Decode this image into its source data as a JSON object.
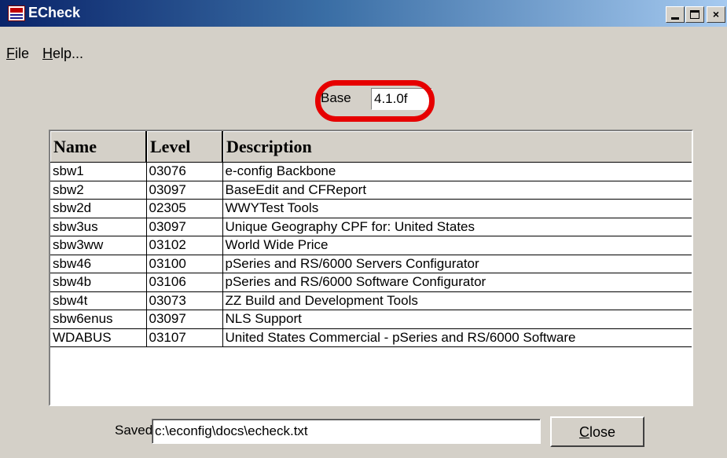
{
  "window": {
    "title": "ECheck",
    "controls": {
      "minimize": "_",
      "maximize": "□",
      "close": "×"
    }
  },
  "menu": {
    "file_label": "File",
    "help_label": "Help...",
    "file_mnemonic": "F",
    "file_rest": "ile",
    "help_mnemonic": "H",
    "help_rest": "elp..."
  },
  "base": {
    "label": "Base",
    "value": "4.1.0f"
  },
  "highlight_color": "#e60000",
  "table": {
    "columns": [
      "Name",
      "Level",
      "Description"
    ],
    "rows": [
      [
        "sbw1",
        "03076",
        "e-config Backbone"
      ],
      [
        "sbw2",
        "03097",
        "BaseEdit and CFReport"
      ],
      [
        "sbw2d",
        "02305",
        "WWYTest Tools"
      ],
      [
        "sbw3us",
        "03097",
        "Unique Geography CPF for: United States"
      ],
      [
        "sbw3ww",
        "03102",
        "World Wide Price"
      ],
      [
        "sbw46",
        "03100",
        "pSeries and RS/6000 Servers Configurator"
      ],
      [
        "sbw4b",
        "03106",
        "pSeries and RS/6000 Software Configurator"
      ],
      [
        "sbw4t",
        "03073",
        "ZZ Build and Development Tools"
      ],
      [
        "sbw6enus",
        "03097",
        "NLS Support"
      ],
      [
        "WDABUS",
        "03107",
        "United States Commercial - pSeries and RS/6000 Software"
      ]
    ]
  },
  "saved": {
    "label": "Saved",
    "path": "c:\\econfig\\docs\\echeck.txt"
  },
  "close_button": {
    "label": "Close",
    "mnemonic": "C",
    "rest": "lose"
  }
}
